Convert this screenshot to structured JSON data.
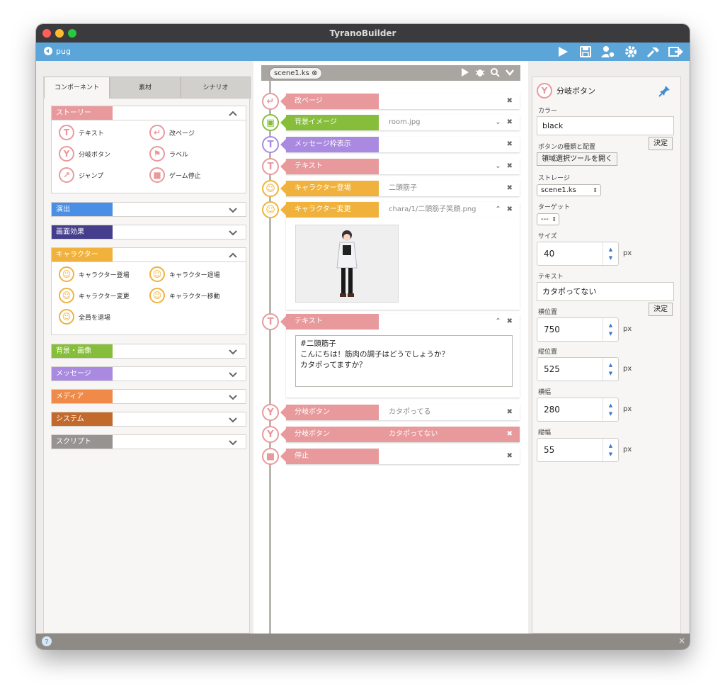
{
  "window": {
    "title": "TyranoBuilder"
  },
  "toolbar": {
    "project": "pug"
  },
  "left": {
    "tabs": [
      "コンポーネント",
      "素材",
      "シナリオ"
    ],
    "categories": {
      "story": {
        "label": "ストーリー",
        "color": "#e8999b"
      },
      "effects": {
        "label": "演出",
        "color": "#4a8fe6"
      },
      "screen": {
        "label": "画面効果",
        "color": "#443e8c"
      },
      "character": {
        "label": "キャラクター",
        "color": "#f0b23c"
      },
      "background": {
        "label": "背景・画像",
        "color": "#86be3b"
      },
      "message": {
        "label": "メッセージ",
        "color": "#a98ae0"
      },
      "media": {
        "label": "メディア",
        "color": "#ef8a48"
      },
      "system": {
        "label": "システム",
        "color": "#c26a2c"
      },
      "script": {
        "label": "スクリプト",
        "color": "#979390"
      }
    },
    "story_items": [
      "テキスト",
      "改ページ",
      "分岐ボタン",
      "ラベル",
      "ジャンプ",
      "ゲーム停止"
    ],
    "character_items": [
      "キャラクター登場",
      "キャラクター退場",
      "キャラクター変更",
      "キャラクター移動",
      "全員を退場"
    ]
  },
  "center": {
    "file_tab": "scene1.ks",
    "rows": {
      "r1": {
        "label": "改ページ",
        "value": ""
      },
      "r2": {
        "label": "背景イメージ",
        "value": "room.jpg"
      },
      "r3": {
        "label": "メッセージ枠表示",
        "value": ""
      },
      "r4": {
        "label": "テキスト",
        "value": ""
      },
      "r5": {
        "label": "キャラクター登場",
        "value": "二頭筋子"
      },
      "r6": {
        "label": "キャラクター変更",
        "value": "chara/1/二頭筋子笑顔.png"
      },
      "r7": {
        "label": "テキスト",
        "value": ""
      },
      "r8": {
        "label": "分岐ボタン",
        "value": "カタポってる"
      },
      "r9": {
        "label": "分岐ボタン",
        "value": "カタポってない"
      },
      "r10": {
        "label": "停止",
        "value": ""
      }
    },
    "text_lines": [
      "#二頭筋子",
      "こんにちは！筋肉の調子はどうでしょうか？",
      "カタポってますか？"
    ]
  },
  "right": {
    "title": "分岐ボタン",
    "color_label": "カラー",
    "color_value": "black",
    "decide": "決定",
    "type_label": "ボタンの種類と配置",
    "region_button": "領域選択ツールを開く",
    "storage_label": "ストレージ",
    "storage_value": "scene1.ks",
    "target_label": "ターゲット",
    "target_value": "---",
    "size_label": "サイズ",
    "size_value": "40",
    "text_label": "テキスト",
    "text_value": "カタポってない",
    "x_label": "横位置",
    "x_value": "750",
    "y_label": "縦位置",
    "y_value": "525",
    "w_label": "横幅",
    "w_value": "280",
    "h_label": "縦幅",
    "h_value": "55",
    "unit": "px"
  }
}
